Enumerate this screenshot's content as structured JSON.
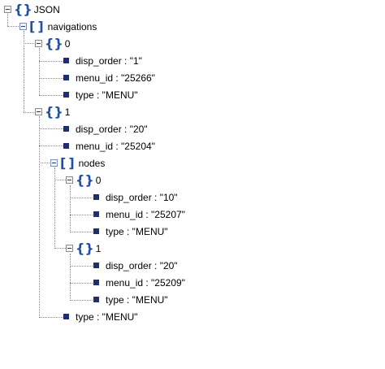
{
  "tree": {
    "root": {
      "label": "JSON",
      "icon": "object-braces-icon"
    },
    "navigations": {
      "label": "navigations",
      "icon": "array-brackets-icon"
    },
    "nav0": {
      "label": "0",
      "disp_order": "disp_order : \"1\"",
      "menu_id": "menu_id : \"25266\"",
      "type": "type : \"MENU\""
    },
    "nav1": {
      "label": "1",
      "disp_order": "disp_order : \"20\"",
      "menu_id": "menu_id : \"25204\"",
      "nodes_label": "nodes",
      "node0": {
        "label": "0",
        "disp_order": "disp_order : \"10\"",
        "menu_id": "menu_id : \"25207\"",
        "type": "type : \"MENU\""
      },
      "node1": {
        "label": "1",
        "disp_order": "disp_order : \"20\"",
        "menu_id": "menu_id : \"25209\"",
        "type": "type : \"MENU\""
      },
      "type": "type : \"MENU\""
    }
  },
  "colors": {
    "accent": "#1f4fae",
    "bullet": "#1f2f6e",
    "connector": "#8a8a8a"
  }
}
